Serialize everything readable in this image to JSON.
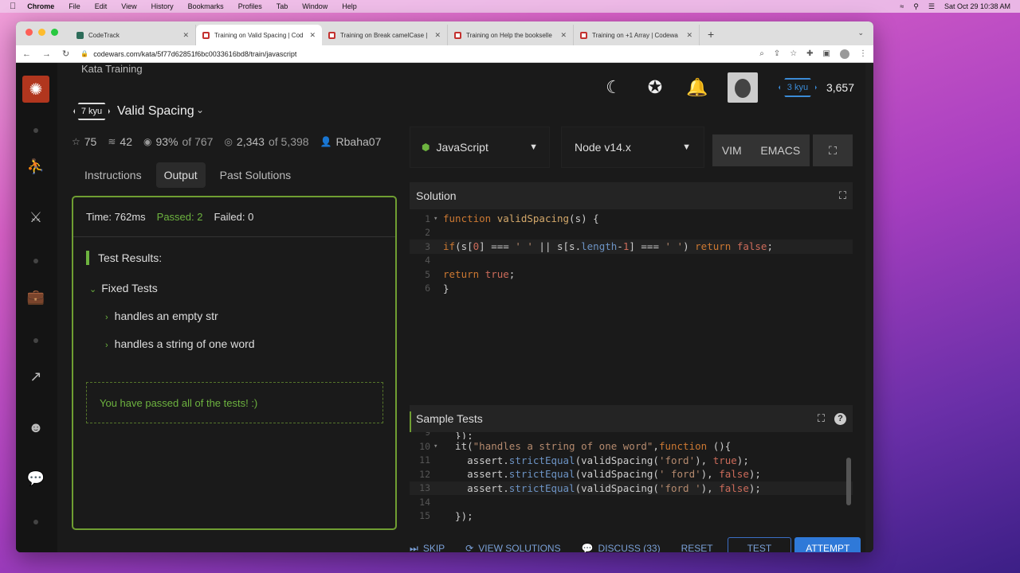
{
  "menubar": {
    "app": "Chrome",
    "items": [
      "File",
      "Edit",
      "View",
      "History",
      "Bookmarks",
      "Profiles",
      "Tab",
      "Window",
      "Help"
    ],
    "datetime": "Sat Oct 29  10:38 AM"
  },
  "browser": {
    "tabs": [
      {
        "label": "CodeTrack",
        "icon": "codetrack-icon"
      },
      {
        "label": "Training on Valid Spacing | Cod",
        "icon": "codewars-icon"
      },
      {
        "label": "Training on Break camelCase |",
        "icon": "codewars-icon"
      },
      {
        "label": "Training on Help the bookselle",
        "icon": "codewars-icon"
      },
      {
        "label": "Training on +1 Array | Codewa",
        "icon": "codewars-icon"
      }
    ],
    "url": "codewars.com/kata/5f77d62851f6bc0033616bd8/train/javascript"
  },
  "header": {
    "section": "Kata Training",
    "rank": "3 kyu",
    "honor": "3,657"
  },
  "kata": {
    "kyu": "7 kyu",
    "title": "Valid Spacing",
    "stars": "75",
    "collections": "42",
    "satisfaction": "93%",
    "satisfaction_of": "of 767",
    "completed": "2,343",
    "completed_of": "of 5,398",
    "author": "Rbaha07"
  },
  "left_tabs": [
    "Instructions",
    "Output",
    "Past Solutions"
  ],
  "output": {
    "time": "Time: 762ms",
    "passed": "Passed: 2",
    "failed": "Failed: 0",
    "results_title": "Test Results:",
    "group": "Fixed Tests",
    "tests": [
      "handles an empty str",
      "handles a string of one word"
    ],
    "message": "You have passed all of the tests! :)"
  },
  "editor": {
    "language": "JavaScript",
    "version": "Node v14.x",
    "modes": [
      "VIM",
      "EMACS"
    ],
    "solution_title": "Solution",
    "sample_title": "Sample Tests"
  },
  "actions": {
    "skip": "SKIP",
    "view_solutions": "VIEW SOLUTIONS",
    "discuss": "DISCUSS (33)",
    "reset": "RESET",
    "test": "TEST",
    "attempt": "ATTEMPT"
  }
}
